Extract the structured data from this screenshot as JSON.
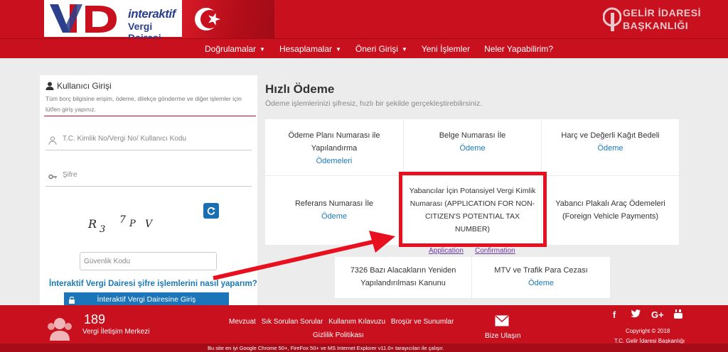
{
  "header": {
    "logo_line1": "interaktif",
    "logo_line2": "Vergi Dairesi",
    "gib_line1": "GELİR İDARESİ",
    "gib_line2": "BAŞKANLIĞI"
  },
  "nav": {
    "items": [
      {
        "label": "Doğrulamalar",
        "dropdown": true
      },
      {
        "label": "Hesaplamalar",
        "dropdown": true
      },
      {
        "label": "Öneri Girişi",
        "dropdown": true
      },
      {
        "label": "Yeni İşlemler",
        "dropdown": false
      },
      {
        "label": "Neler Yapabilirim?",
        "dropdown": false
      }
    ]
  },
  "login": {
    "title": "Kullanıcı Girişi",
    "description": "Tüm borç bilgisine erişim, ödeme, dilekçe gönderme ve diğer işlemler için lütfen giriş yapınız.",
    "user_placeholder": "T.C. Kimlik No/Vergi No/ Kullanıcı Kodu",
    "password_placeholder": "Şifre",
    "captcha_chars": [
      "R",
      "3",
      "7",
      "P",
      "V"
    ],
    "captcha_placeholder": "Güvenlik Kodu",
    "help_link": "İnteraktif Vergi Dairesi şifre işlemlerini nasıl yaparım?",
    "submit_label": "İnteraktif Vergi Dairesine Giriş"
  },
  "main": {
    "title": "Hızlı Ödeme",
    "subtitle": "Ödeme işlemlerinizi şifresiz, hızlı bir şekilde gerçekleştirebilirsiniz.",
    "cards": [
      {
        "text": "Ödeme Planı Numarası ile Yapılandırma",
        "link": "Ödemeleri"
      },
      {
        "text": "Belge Numarası İle",
        "link": "Ödeme"
      },
      {
        "text": "Harç ve Değerli Kağıt Bedeli",
        "link": "Ödeme"
      },
      {
        "text": "Referans Numarası İle",
        "link": "Ödeme"
      },
      {
        "text": "Yabancılar İçin Potansiyel Vergi Kimlik Numarası (APPLICATION FOR NON-CITIZEN'S POTENTIAL TAX NUMBER)",
        "link": ""
      },
      {
        "text": "Yabancı Plakalı Araç Ödemeleri (Foreign Vehicle Payments)",
        "link": ""
      }
    ],
    "application_link": "Application",
    "confirmation_link": "Confirmation",
    "bottom_cards": [
      {
        "text": "7326 Bazı Alacakların Yeniden Yapılandırılması Kanunu",
        "link": ""
      },
      {
        "text": "MTV ve Trafik Para Cezası",
        "link": "Ödeme"
      }
    ]
  },
  "footer": {
    "call_number": "189",
    "call_label": "Vergi İletişim Merkezi",
    "links": [
      "Mevzuat",
      "Sık Sorulan Sorular",
      "Kullanım Kılavuzu",
      "Broşür ve Sunumlar"
    ],
    "privacy": "Gizlilik Politikası",
    "contact": "Bize Ulaşın",
    "copyright": "Copyright © 2018",
    "org": "T.C. Gelir İdaresi Başkanlığı",
    "browser_note": "Bu site en iyi Google Chrome 50+, FireFox 50+ ve MS Internet Explorer v11.0+ tarayıcıları ile çalışır.",
    "social_icons": [
      "facebook-icon",
      "twitter-icon",
      "google-plus-icon",
      "youtube-icon"
    ]
  },
  "colors": {
    "brand_red": "#c8101e",
    "link_blue": "#1a7ab8",
    "highlight_red": "#e8101e"
  }
}
